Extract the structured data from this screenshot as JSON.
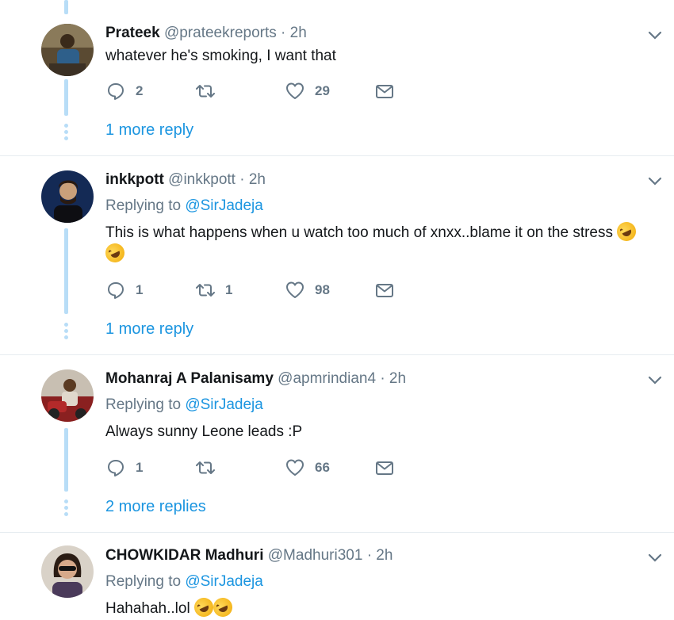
{
  "tweets": [
    {
      "name": "Prateek",
      "handle": "@prateekreports",
      "time": "2h",
      "replying_label": "",
      "replying_to": "",
      "text": "whatever he's smoking, I want that",
      "replies": "2",
      "retweets": "",
      "likes": "29",
      "more_replies": "1 more reply"
    },
    {
      "name": "inkkpott",
      "handle": "@inkkpott",
      "time": "2h",
      "replying_label": "Replying to",
      "replying_to": "@SirJadeja",
      "text": "This is what happens when u watch too much of xnxx..blame it on the stress",
      "replies": "1",
      "retweets": "1",
      "likes": "98",
      "more_replies": "1 more reply"
    },
    {
      "name": "Mohanraj A Palanisamy",
      "handle": "@apmrindian4",
      "time": "2h",
      "replying_label": "Replying to",
      "replying_to": "@SirJadeja",
      "text": "Always sunny Leone leads :P",
      "replies": "1",
      "retweets": "",
      "likes": "66",
      "more_replies": "2 more replies"
    },
    {
      "name": "CHOWKIDAR Madhuri",
      "handle": "@Madhuri301",
      "time": "2h",
      "replying_label": "Replying to",
      "replying_to": "@SirJadeja",
      "text": "Hahahah..lol"
    }
  ],
  "separator": "·",
  "icons": {
    "reply": "reply-icon",
    "retweet": "retweet-icon",
    "like": "heart-icon",
    "dm": "envelope-icon",
    "caret": "chevron-down-icon",
    "emoji": "rolling-on-floor-laughing-emoji"
  },
  "colors": {
    "link": "#1b95e0",
    "muted": "#657786",
    "thread_line": "#b8ddf7",
    "divider": "#e6ecf0"
  }
}
